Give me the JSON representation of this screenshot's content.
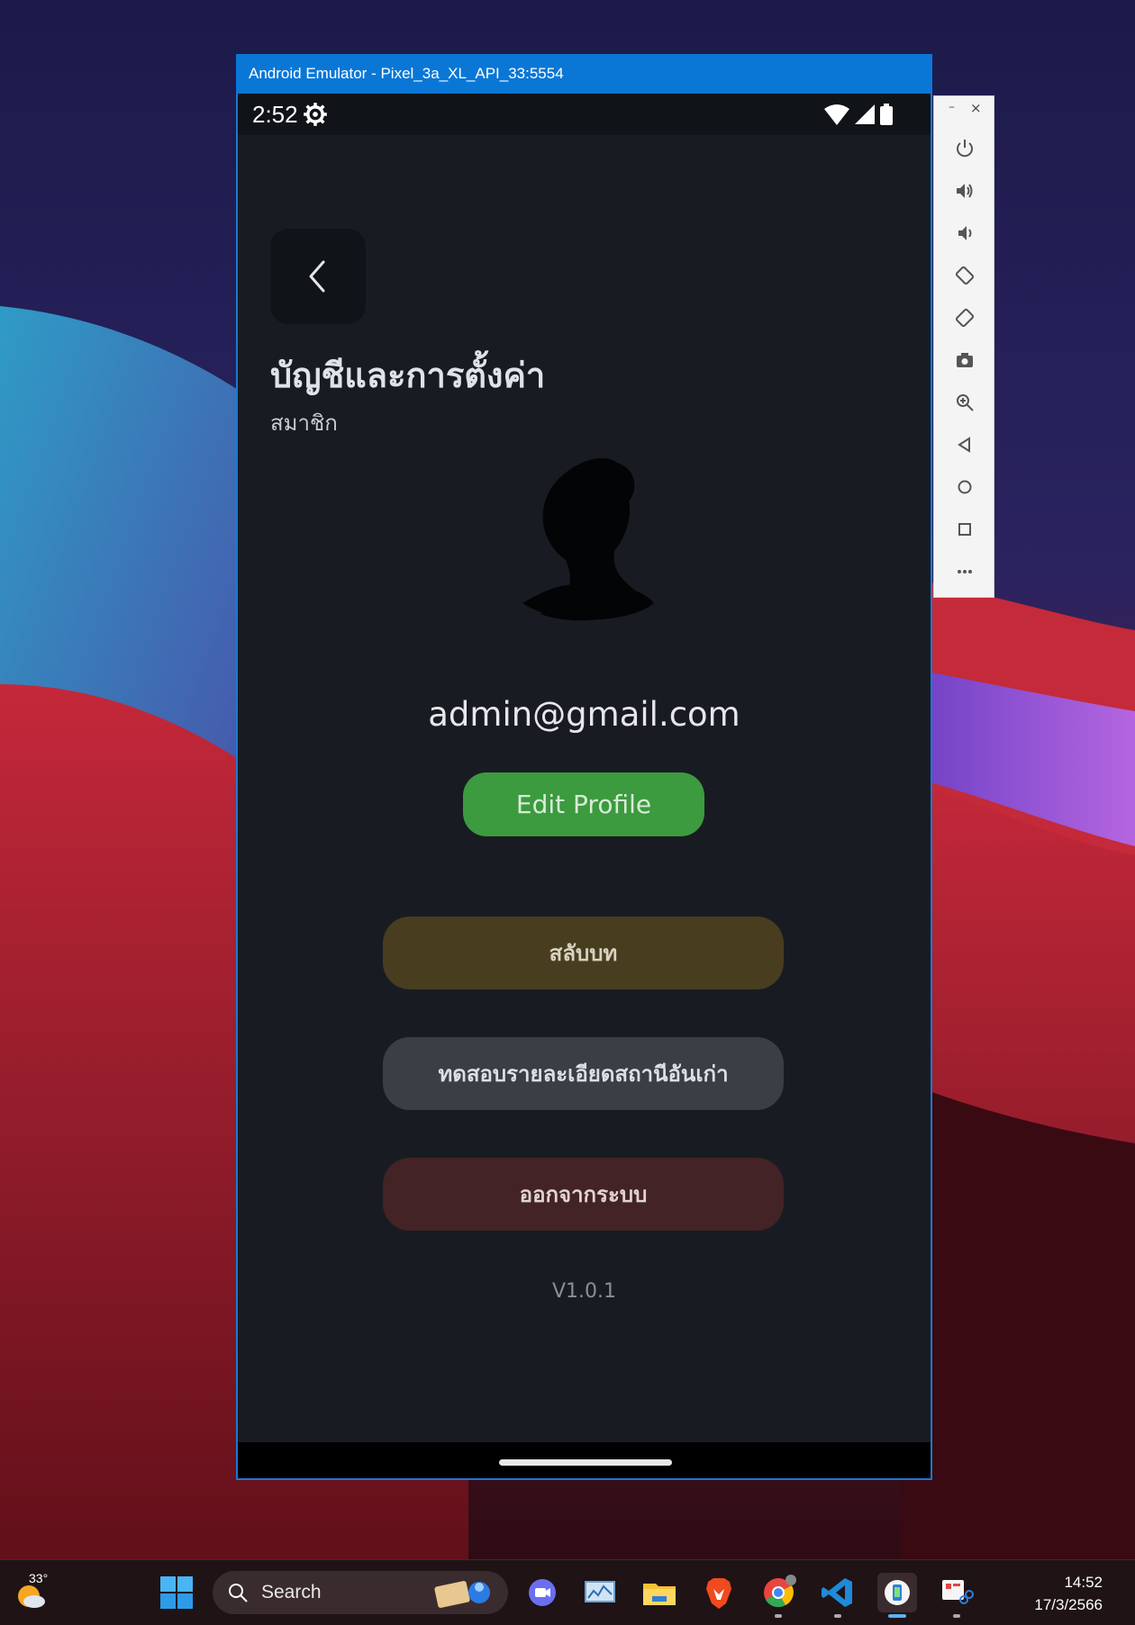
{
  "emulator": {
    "title": "Android Emulator - Pixel_3a_XL_API_33:5554"
  },
  "statusbar": {
    "time": "2:52"
  },
  "app": {
    "title": "บัญชีและการตั้งค่า",
    "subtitle": "สมาชิก",
    "email": "admin@gmail.com",
    "edit_profile_label": "Edit Profile",
    "menu": {
      "switch_role": "สลับบท",
      "test_station": "ทดสอบรายละเอียดสถานีอันเก่า",
      "logout": "ออกจากระบบ"
    },
    "version": "V1.0.1"
  },
  "side_toolbar": {
    "minimize": "–",
    "close": "×",
    "buttons": [
      "power-icon",
      "volume-up-icon",
      "volume-down-icon",
      "rotate-left-icon",
      "rotate-right-icon",
      "camera-icon",
      "zoom-icon",
      "back-icon",
      "home-icon",
      "overview-icon",
      "more-icon"
    ]
  },
  "taskbar": {
    "weather_temp": "33°",
    "search_label": "Search",
    "clock_time": "14:52",
    "clock_date": "17/3/2566"
  },
  "colors": {
    "accent_blue": "#0a77d6",
    "edit_green": "#3c9a3f",
    "switch_bg": "#483d1f",
    "test_bg": "#3a3e45",
    "logout_bg": "#432326",
    "screen_bg": "#181c22"
  }
}
